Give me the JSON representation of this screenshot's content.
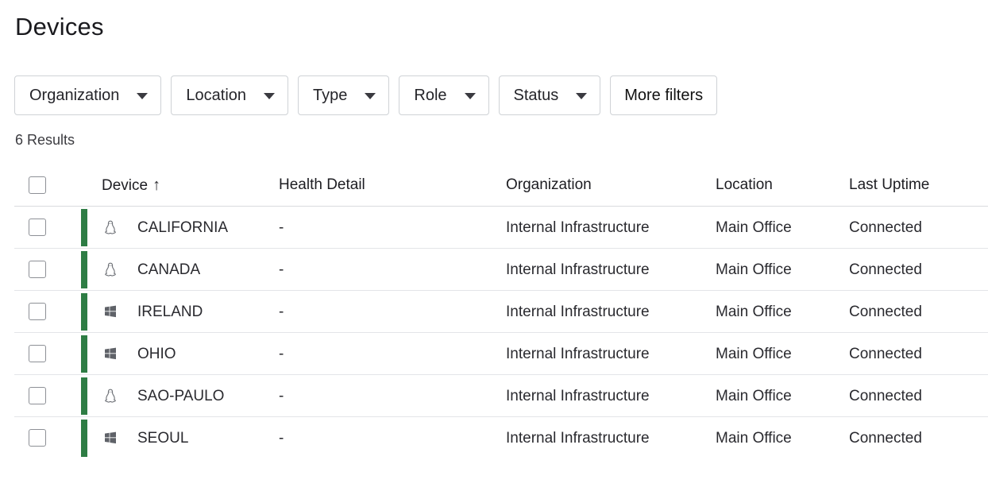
{
  "page": {
    "title": "Devices"
  },
  "filters": [
    {
      "label": "Organization",
      "has_caret": true
    },
    {
      "label": "Location",
      "has_caret": true
    },
    {
      "label": "Type",
      "has_caret": true
    },
    {
      "label": "Role",
      "has_caret": true
    },
    {
      "label": "Status",
      "has_caret": true
    },
    {
      "label": "More filters",
      "has_caret": false
    }
  ],
  "results_text": "6 Results",
  "table": {
    "columns": {
      "device": "Device",
      "device_sort_icon": "↑",
      "health": "Health Detail",
      "organization": "Organization",
      "location": "Location",
      "uptime": "Last Uptime"
    },
    "status_color": "#2e7d44",
    "rows": [
      {
        "os": "linux-icon",
        "device": "CALIFORNIA",
        "health": "-",
        "organization": "Internal Infrastructure",
        "location": "Main Office",
        "uptime": "Connected"
      },
      {
        "os": "linux-icon",
        "device": "CANADA",
        "health": "-",
        "organization": "Internal Infrastructure",
        "location": "Main Office",
        "uptime": "Connected"
      },
      {
        "os": "windows-icon",
        "device": "IRELAND",
        "health": "-",
        "organization": "Internal Infrastructure",
        "location": "Main Office",
        "uptime": "Connected"
      },
      {
        "os": "windows-icon",
        "device": "OHIO",
        "health": "-",
        "organization": "Internal Infrastructure",
        "location": "Main Office",
        "uptime": "Connected"
      },
      {
        "os": "linux-icon",
        "device": "SAO-PAULO",
        "health": "-",
        "organization": "Internal Infrastructure",
        "location": "Main Office",
        "uptime": "Connected"
      },
      {
        "os": "windows-icon",
        "device": "SEOUL",
        "health": "-",
        "organization": "Internal Infrastructure",
        "location": "Main Office",
        "uptime": "Connected"
      }
    ]
  }
}
